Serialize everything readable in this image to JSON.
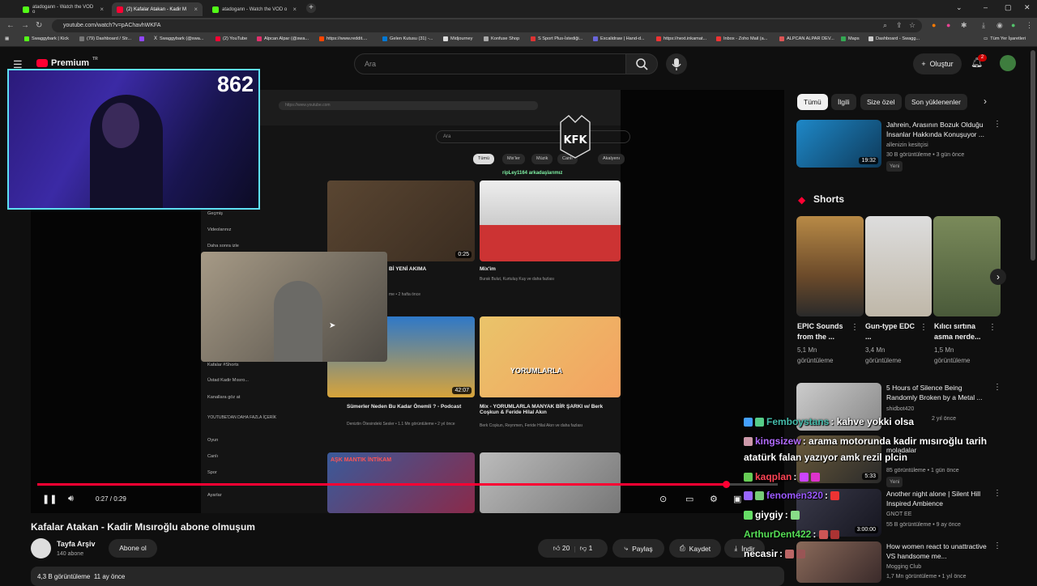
{
  "browser": {
    "tabs": [
      {
        "title": "atadogann - Watch the VOD o"
      },
      {
        "title": "(2) Kafalar Atakan - Kadir M"
      },
      {
        "title": "atadogann - Watch the VOD o"
      }
    ],
    "url": "youtube.com/watch?v=pAChavhWKFA",
    "bookmarks": [
      "Swaggybark | Kick",
      "(79) Dashboard / Str...",
      "Swaggybark (@swa...",
      "(2) YouTube",
      "Alpcan Alpar (@swa...",
      "https://www.reddit....",
      "Gelen Kutusu (31) -...",
      "Midjourney",
      "Konfuse Shop",
      "S Sport Plus-İstediği...",
      "Excalidraw | Hand-d...",
      "https://next.inkamat...",
      "Inbox - Zoho Mail (a...",
      "ALPCAN ALPAR DEV...",
      "Maps",
      "Dashboard - Swagg..."
    ],
    "all_bookmarks": "Tüm Yer İşaretleri"
  },
  "header": {
    "logo": "Premium",
    "region": "TR",
    "search_placeholder": "Ara",
    "create_label": "Oluştur",
    "notification_count": "2"
  },
  "webcam": {
    "viewer_count": "862"
  },
  "inner_page": {
    "url": "https://www.youtube.com",
    "search": "Ara",
    "chips": [
      "Tümü",
      "Mix'ler",
      "Müzik",
      "Canlı",
      "Akalyenı"
    ],
    "channel_logo": "KFK",
    "overlay_text": "ripLey1164 arkadaşlarımız",
    "sidebar": [
      "Geçmiş",
      "Videolarınız",
      "Daha sonra izle",
      "Kafalar #Shorts",
      "Üstad Kadir Mısıro...",
      "Kanallara göz at",
      "YOUTUBE'DAN DAHA FAZLA İÇERİK",
      "Oyun",
      "Canlı",
      "Spor",
      "Ayarlar"
    ],
    "videos": [
      {
        "title": "Bİ YENİ AKIMA",
        "meta": "me • 2 hafta önce",
        "duration": "0:25"
      },
      {
        "title": "Mix'im",
        "meta": "Burak Bulut, Kurtuluş Kuş ve daha fazlası"
      },
      {
        "title": "Sümerler Neden Bu Kadar Önemli ? - Podcast",
        "meta": "Deniztin Ötesindeki Sesler • 1.1 Mn görüntüleme • 2 yıl önce",
        "duration": "42:07"
      },
      {
        "title": "Mix - YORUMLARLA MANYAK BİR ŞARKI w/ Berk Coşkun & Feride Hilal Akın",
        "meta": "Berk Coşkun, Reynmen, Feride Hilal Akın ve daha fazlası"
      },
      {
        "title": "AŞK MANTIK İNTİKAM",
        "meta": ""
      }
    ],
    "yorumlarla_text": "YORUMLARLA"
  },
  "player": {
    "time_current": "0:27",
    "time_total": "0:29",
    "time_label": "0:27 / 0:29",
    "progress": 0.93
  },
  "video": {
    "title": "Kafalar Atakan - Kadir Mısıroğlu abone olmuşum",
    "channel": "Tayfa Arşiv",
    "subscribers": "140 abone",
    "subscribe_label": "Abone ol",
    "likes": "20",
    "dislikes": "1",
    "share_label": "Paylaş",
    "save_label": "Kaydet",
    "download_label": "İndir",
    "views": "4,3 B görüntüleme",
    "uploaded": "11 ay önce"
  },
  "sidebar": {
    "chips": [
      "Tümü",
      "İlgili",
      "Size özel",
      "Son yüklenenler"
    ],
    "rec1": {
      "title": "Jahrein, Arasının Bozuk Olduğu İnsanlar Hakkında Konuşuyor ...",
      "channel": "allenizin kesitçisi",
      "meta": "30 B görüntüleme • 3 gün önce",
      "badge": "Yeni",
      "duration": "19:32"
    },
    "shorts_title": "Shorts",
    "shorts": [
      {
        "title": "EPIC Sounds from the ...",
        "views": "5,1 Mn görüntüleme"
      },
      {
        "title": "Gun-type EDC ...",
        "views": "3,4 Mn görüntüleme"
      },
      {
        "title": "Kılıcı sırtına asma nerde...",
        "views": "1,5 Mn görüntüleme"
      }
    ],
    "rec2": {
      "title": "5 Hours of Silence Being Randomly Broken by a Metal ...",
      "channel": "shidbot420",
      "meta": "2 yıl önce"
    },
    "rec3": {
      "title": "moladalar",
      "meta": "85 görüntüleme • 1 gün önce",
      "badge": "Yeni",
      "duration": "5:33"
    },
    "rec4": {
      "title": "Another night alone | Silent Hill Inspired Ambience",
      "channel": "GNOT EE",
      "meta": "55 B görüntüleme • 9 ay önce",
      "duration": "3:00:00"
    },
    "rec5": {
      "title": "How women react to unattractive VS handsome me...",
      "channel": "Mogging Club",
      "meta": "1,7 Mn görüntüleme • 1 yıl önce"
    }
  },
  "chat": [
    {
      "user": "Femboystans",
      "msg": "kahve yokki olsa",
      "color": "#44bbaa"
    },
    {
      "user": "kingsizew",
      "msg": "arama motorunda kadir mısıroğlu tarih",
      "color": "#b26bff"
    },
    {
      "user": "",
      "msg": "atatürk falan yazıyor amk rezil plcin",
      "color": "#ffffff"
    },
    {
      "user": "kaqplan",
      "msg": "",
      "color": "#ff4455"
    },
    {
      "user": "fenomen320",
      "msg": "",
      "color": "#9b59ff"
    },
    {
      "user": "giygiy",
      "msg": "",
      "color": "#ffffff"
    },
    {
      "user": "ArthurDent422",
      "msg": "",
      "color": "#55dd55"
    },
    {
      "user": "necasir",
      "msg": "",
      "color": "#ffffff"
    }
  ],
  "colors": {
    "accent": "#ff0033",
    "kick": "#53fc18",
    "webcam_border": "#5ee0f5"
  }
}
